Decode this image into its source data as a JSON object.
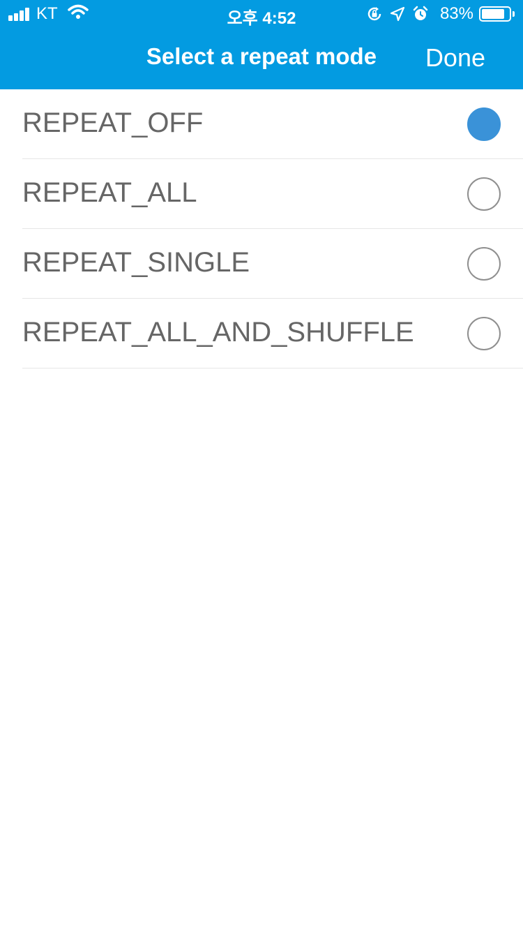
{
  "status_bar": {
    "carrier": "KT",
    "time": "오후 4:52",
    "battery_percent": "83%",
    "battery_level": 0.83,
    "icons": [
      "signal-icon",
      "wifi-icon",
      "orientation-lock-icon",
      "location-icon",
      "alarm-icon",
      "battery-icon"
    ]
  },
  "header": {
    "title": "Select a repeat mode",
    "done_label": "Done",
    "background_color": "#039be1"
  },
  "options": [
    {
      "label": "REPEAT_OFF",
      "selected": true
    },
    {
      "label": "REPEAT_ALL",
      "selected": false
    },
    {
      "label": "REPEAT_SINGLE",
      "selected": false
    },
    {
      "label": "REPEAT_ALL_AND_SHUFFLE",
      "selected": false
    }
  ],
  "colors": {
    "selected_radio": "#3a92d8",
    "unselected_radio_border": "#8f8f8f",
    "label_text": "#666666"
  }
}
